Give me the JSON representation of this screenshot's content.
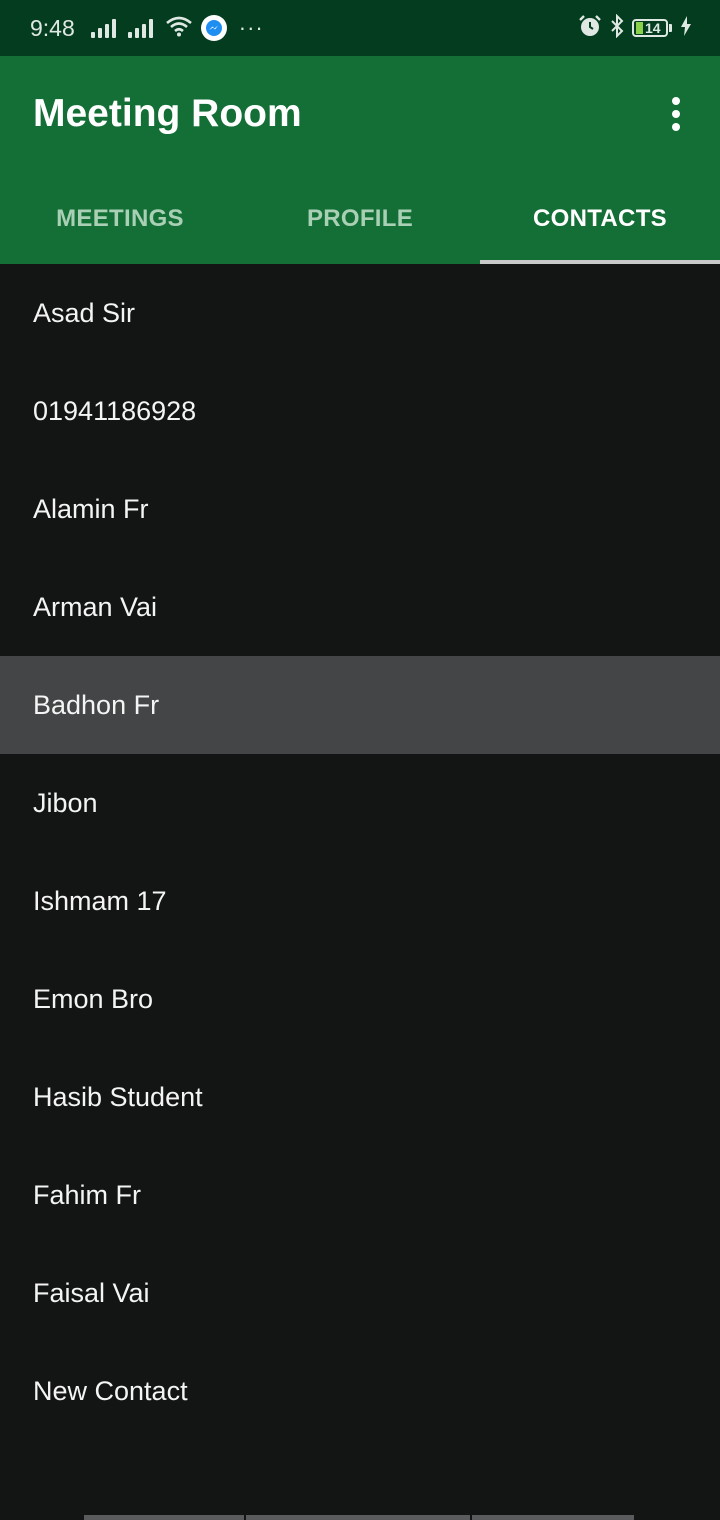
{
  "status_bar": {
    "time": "9:48",
    "battery": "14",
    "icons": [
      "signal-icon",
      "signal-icon",
      "wifi-icon",
      "messenger-icon",
      "more-dots-icon",
      "alarm-icon",
      "bluetooth-icon",
      "battery-icon",
      "charging-icon"
    ]
  },
  "app_bar": {
    "title": "Meeting Room",
    "menu_icon": "more-vert-icon",
    "color": "#136f36"
  },
  "tabs": [
    {
      "label": "MEETINGS",
      "active": false
    },
    {
      "label": "PROFILE",
      "active": false
    },
    {
      "label": "CONTACTS",
      "active": true
    }
  ],
  "contacts": [
    {
      "name": "Asad Sir"
    },
    {
      "name": "01941186928"
    },
    {
      "name": "Alamin Fr"
    },
    {
      "name": "Arman Vai"
    },
    {
      "name": "Badhon Fr",
      "highlighted": true
    },
    {
      "name": "Jibon"
    },
    {
      "name": "Ishmam 17"
    },
    {
      "name": "Emon Bro"
    },
    {
      "name": "Hasib Student"
    },
    {
      "name": "Fahim Fr"
    },
    {
      "name": "Faisal Vai"
    },
    {
      "name": "New Contact"
    }
  ],
  "colors": {
    "status_bar": "#033c1f",
    "background": "#131414",
    "highlight": "#444546"
  }
}
